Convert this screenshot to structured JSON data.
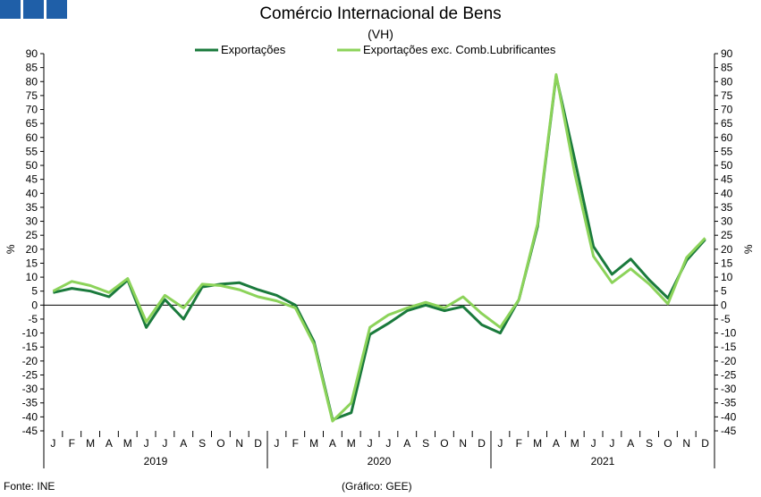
{
  "logo_color": "#1f5fa8",
  "title": "Comércio Internacional de Bens",
  "subtitle": "(VH)",
  "source": "Fonte: INE",
  "credit": "(Gráfico: GEE)",
  "chart_data": {
    "type": "line",
    "title": "Comércio Internacional de Bens",
    "subtitle": "(VH)",
    "ylabel_left": "%",
    "ylabel_right": "%",
    "ylim": [
      -45,
      90
    ],
    "ytick_step": 5,
    "grid": false,
    "legend_position": "top-center",
    "month_labels": [
      "J",
      "F",
      "M",
      "A",
      "M",
      "J",
      "J",
      "A",
      "S",
      "O",
      "N",
      "D"
    ],
    "years": [
      "2019",
      "2020",
      "2021"
    ],
    "series": [
      {
        "name": "Exportações",
        "color": "#1a7a3c",
        "values": [
          4.5,
          6,
          5,
          3,
          9,
          -8,
          2,
          -5,
          6.5,
          7.5,
          8,
          5.5,
          3.5,
          0,
          -13,
          -41,
          -38.5,
          -10.5,
          -6.5,
          -2,
          0,
          -2,
          -0.5,
          -7,
          -10,
          2,
          28,
          82,
          52,
          21,
          11,
          16.5,
          9,
          2.5,
          16,
          23.5
        ]
      },
      {
        "name": "Exportações exc. Comb.Lubrificantes",
        "color": "#8cd35a",
        "values": [
          5,
          8.5,
          7,
          4.5,
          9.5,
          -6,
          3.5,
          -1,
          7.5,
          7,
          5.5,
          3,
          1.5,
          -1,
          -14,
          -41.5,
          -35,
          -8,
          -3.5,
          -1,
          1,
          -1,
          3,
          -3,
          -8,
          2,
          29,
          82.5,
          47,
          17.5,
          8,
          13,
          7.5,
          0.5,
          17,
          24
        ]
      }
    ]
  }
}
